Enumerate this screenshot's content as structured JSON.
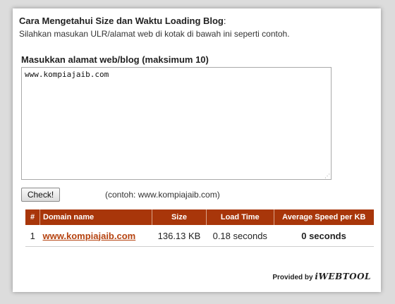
{
  "header": {
    "title_bold": "Cara Mengetahui Size dan Waktu Loading Blog",
    "title_colon": ":",
    "subtitle": "Silahkan masukan ULR/alamat web di kotak di bawah ini seperti contoh."
  },
  "form": {
    "label": "Masukkan alamat web/blog (maksimum 10)",
    "textarea_value": "www.kompiajaib.com",
    "check_button": "Check!",
    "example": "(contoh: www.kompiajaib.com)"
  },
  "table": {
    "columns": [
      "#",
      "Domain name",
      "Size",
      "Load Time",
      "Average Speed per KB"
    ],
    "rows": [
      {
        "num": "1",
        "domain": "www.kompiajaib.com",
        "size": "136.13 KB",
        "load_time": "0.18 seconds",
        "speed": "0 seconds"
      }
    ]
  },
  "footer": {
    "provided_by": "Provided by",
    "logo_text": "iWEBTOOL"
  },
  "colors": {
    "header_bg": "#a8360a",
    "link": "#b5420f"
  }
}
